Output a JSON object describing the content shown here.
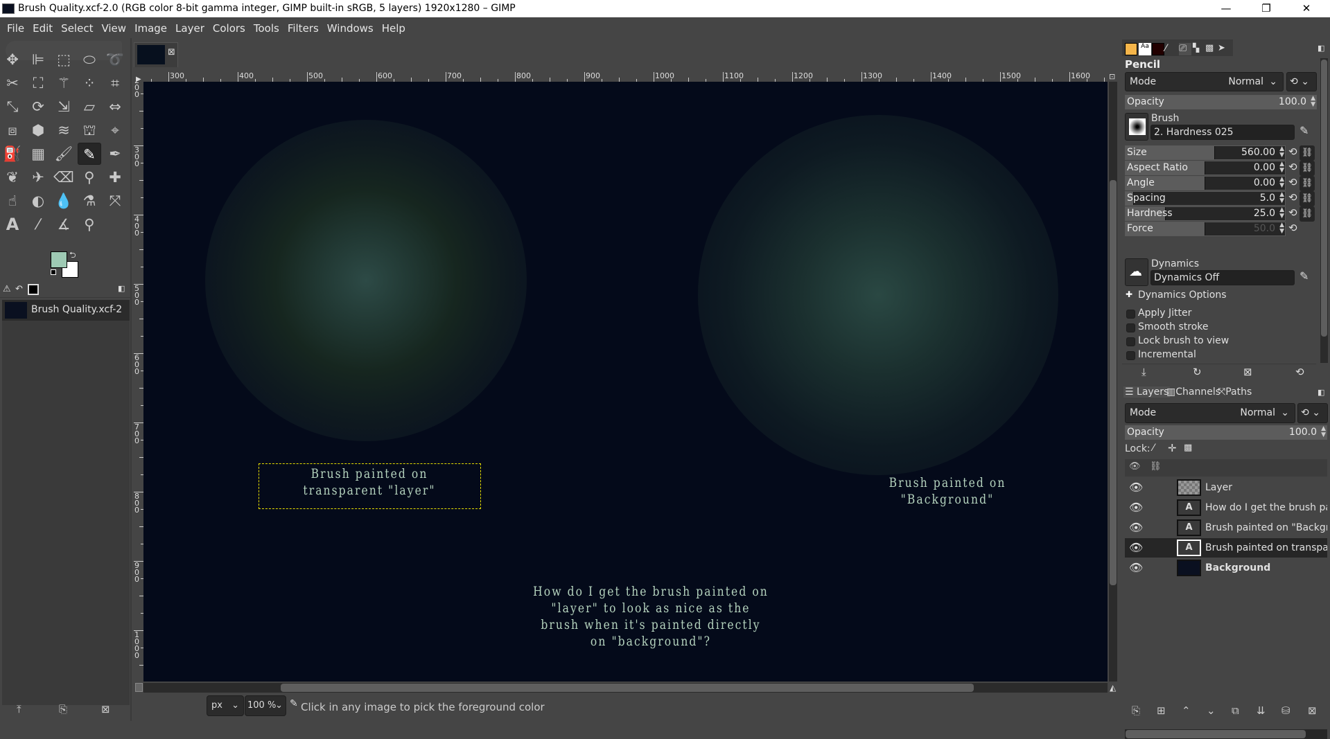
{
  "window": {
    "title": "Brush Quality.xcf-2.0 (RGB color 8-bit gamma integer, GIMP built-in sRGB, 5 layers) 1920x1280 – GIMP",
    "minimize": "—",
    "restore": "❐",
    "close": "✕"
  },
  "menu": [
    "File",
    "Edit",
    "Select",
    "View",
    "Image",
    "Layer",
    "Colors",
    "Tools",
    "Filters",
    "Windows",
    "Help"
  ],
  "toolbox": {
    "tools": [
      "move",
      "align",
      "rect-select",
      "ellipse-select",
      "free-select",
      "scissors-select",
      "foreground-select",
      "fuzzy-select",
      "select-by-color",
      "crop",
      "unified-transform",
      "rotate",
      "scale",
      "shear",
      "flip",
      "perspective",
      "3d-transform",
      "warp",
      "cage",
      "handle-transform",
      "bucket-fill",
      "gradient",
      "paintbrush",
      "pencil",
      "ink",
      "mypaint",
      "airbrush",
      "eraser",
      "clone",
      "heal",
      "smudge",
      "dodge-burn",
      "blur",
      "convolve",
      "paths",
      "text",
      "color-picker",
      "measure",
      "zoom"
    ],
    "active_tool": "pencil",
    "foreground_color": "#9ecab4",
    "background_color": "#ffffff",
    "images_item": "Brush Quality.xcf-2"
  },
  "rulers": {
    "horizontal": [
      300,
      400,
      500,
      600,
      700,
      800,
      900,
      1000,
      1100,
      1200,
      1300,
      1400,
      1500,
      1600
    ],
    "vertical": [
      200,
      300,
      400,
      500,
      600,
      700,
      800,
      900,
      1000
    ]
  },
  "canvas": {
    "background_color": "#040a1a",
    "text_color": "#b5d3be",
    "text_left": [
      "Brush painted on",
      "transparent \"layer\""
    ],
    "text_right": [
      "Brush painted on",
      "\"Background\""
    ],
    "text_question": [
      "How do I get the brush painted on",
      "\"layer\" to look as nice as the",
      "brush when it's painted directly",
      "on \"background\"?"
    ]
  },
  "statusbar": {
    "unit": "px",
    "zoom": "100 %",
    "message": "Click in any image to pick the foreground color"
  },
  "tool_options": {
    "title": "Pencil",
    "mode_label": "Mode",
    "mode_value": "Normal",
    "opacity_label": "Opacity",
    "opacity_value": "100.0",
    "brush_label": "Brush",
    "brush_value": "2. Hardness 025",
    "sliders": [
      {
        "label": "Size",
        "value": "560.00",
        "fill": 0.56
      },
      {
        "label": "Aspect Ratio",
        "value": "0.00",
        "fill": 0.5
      },
      {
        "label": "Angle",
        "value": "0.00",
        "fill": 0.5
      },
      {
        "label": "Spacing",
        "value": "5.0",
        "fill": 0.05
      },
      {
        "label": "Hardness",
        "value": "25.0",
        "fill": 0.25
      },
      {
        "label": "Force",
        "value": "50.0",
        "fill": 0.5
      }
    ],
    "dynamics_label": "Dynamics",
    "dynamics_value": "Dynamics Off",
    "dynamics_options": "Dynamics Options",
    "checkboxes": [
      "Apply Jitter",
      "Smooth stroke",
      "Lock brush to view",
      "Incremental"
    ]
  },
  "layers_panel": {
    "tabs": [
      "Layers",
      "Channels",
      "Paths"
    ],
    "mode_label": "Mode",
    "mode_value": "Normal",
    "opacity_label": "Opacity",
    "opacity_value": "100.0",
    "lock_label": "Lock:",
    "layers": [
      {
        "name": "Layer",
        "type": "raster",
        "selected": false,
        "bold": false
      },
      {
        "name": "How do I get the brush paint",
        "type": "text",
        "selected": false,
        "bold": false
      },
      {
        "name": "Brush painted on \"Backgrour",
        "type": "text",
        "selected": false,
        "bold": false
      },
      {
        "name": "Brush painted on transparent",
        "type": "text",
        "selected": true,
        "bold": false
      },
      {
        "name": "Background",
        "type": "background",
        "selected": false,
        "bold": true
      }
    ]
  }
}
